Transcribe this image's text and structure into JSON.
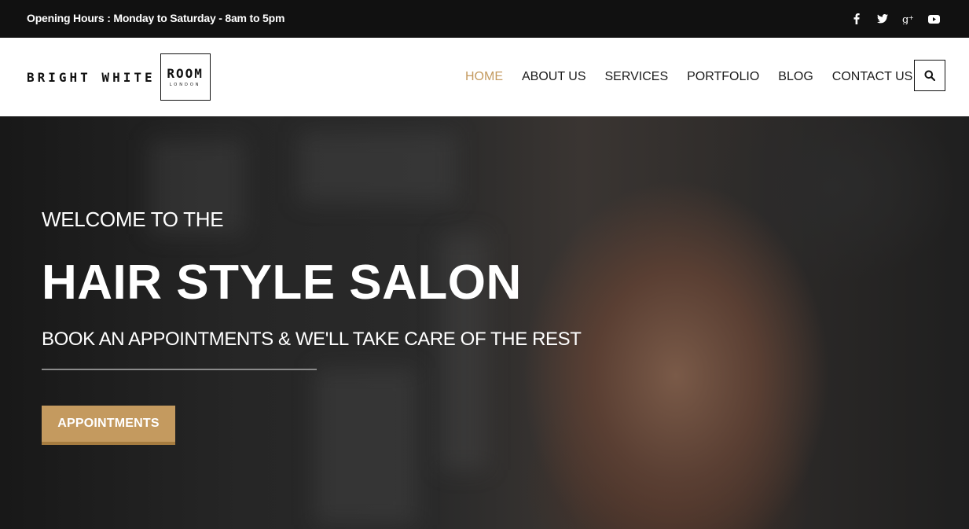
{
  "topbar": {
    "opening_hours": "Opening Hours : Monday to Saturday - 8am to 5pm",
    "social_icons": [
      "facebook-icon",
      "twitter-icon",
      "google-plus-icon",
      "youtube-icon"
    ]
  },
  "header": {
    "logo": {
      "word": "BRIGHT WHITE",
      "boxed_word": "ROOM",
      "sub": "LONDON"
    },
    "nav": [
      {
        "label": "HOME",
        "active": true
      },
      {
        "label": "ABOUT US",
        "active": false
      },
      {
        "label": "SERVICES",
        "active": false
      },
      {
        "label": "PORTFOLIO",
        "active": false
      },
      {
        "label": "BLOG",
        "active": false
      },
      {
        "label": "CONTACT US",
        "active": false
      }
    ],
    "search_icon": "search-icon"
  },
  "hero": {
    "welcome": "WELCOME TO THE",
    "headline": "HAIR STYLE SALON",
    "tagline": "BOOK AN APPOINTMENTS & WE'LL TAKE CARE OF THE REST",
    "cta_label": "APPOINTMENTS"
  },
  "colors": {
    "accent": "#c49a5f",
    "topbar_bg": "#111111",
    "header_bg": "#ffffff",
    "text_dark": "#1a1a1a"
  }
}
